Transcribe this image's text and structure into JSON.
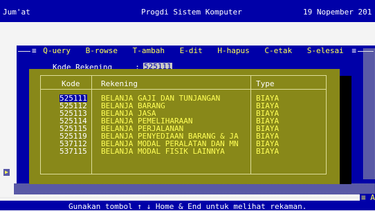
{
  "title_bar": {
    "left": "Jum'at",
    "center": "Progdi Sistem Komputer",
    "right": "19 Nopember 201"
  },
  "menu": {
    "open_marker": "≡",
    "close_marker": "≡",
    "items": [
      "Q-uery",
      "B-rowse",
      "T-ambah",
      "E-dit",
      "H-hapus",
      "C-etak",
      "S-elesai"
    ]
  },
  "form": {
    "kode_label": "Kode Rekening ___ :",
    "kode_value": "525111"
  },
  "table": {
    "headers": {
      "kode": "Kode",
      "rekening": "Rekening",
      "type": "Type"
    },
    "rows": [
      {
        "kode": "525111",
        "rekening": "BELANJA GAJI DAN TUNJANGAN",
        "type": "BIAYA"
      },
      {
        "kode": "525112",
        "rekening": "BELANJA BARANG",
        "type": "BIAYA"
      },
      {
        "kode": "525113",
        "rekening": "BELANJA JASA",
        "type": "BIAYA"
      },
      {
        "kode": "525114",
        "rekening": "BELANJA PEMELIHARAAN",
        "type": "BIAYA"
      },
      {
        "kode": "525115",
        "rekening": "BELANJA PERJALANAN",
        "type": "BIAYA"
      },
      {
        "kode": "525119",
        "rekening": "BELANJA PENYEDIAAN BARANG & JA",
        "type": "BIAYA"
      },
      {
        "kode": "537112",
        "rekening": "BELANJA MODAL PERALATAN DAN MN",
        "type": "BIAYA"
      },
      {
        "kode": "537115",
        "rekening": "BELANJA MODAL FISIK LAINNYA",
        "type": "BIAYA"
      }
    ],
    "selected_index": 0
  },
  "status": {
    "right_label": "≡ ANDI",
    "help": "Gunakan tombol ↑ ↓ Home & End untuk melihat rekaman."
  },
  "colors": {
    "background_blue": "#0000a8",
    "modal_olive": "#888819",
    "highlight_yellow": "#ffff55"
  }
}
